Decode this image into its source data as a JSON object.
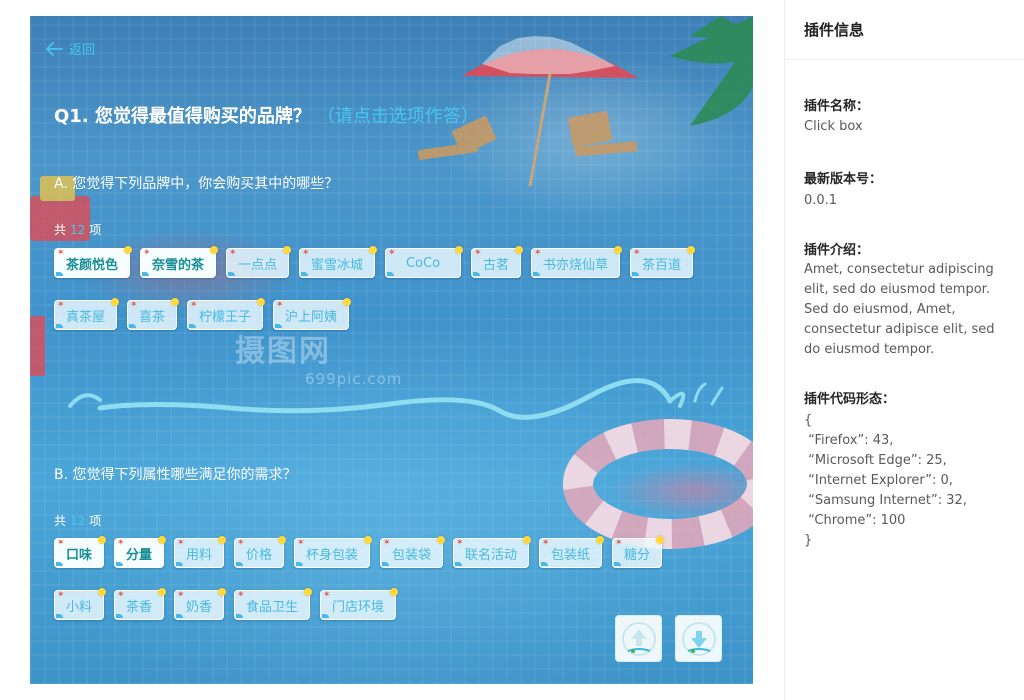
{
  "preview": {
    "back_label": "返回",
    "question_title": "Q1. 您觉得最值得购买的品牌？",
    "question_hint": "（请点击选项作答）",
    "watermark_text": "摄图网",
    "watermark_url": "699pic.com",
    "section_a": {
      "label": "A. 您觉得下列品牌中，你会购买其中的哪些？",
      "count_prefix": "共",
      "count": "12",
      "count_suffix": "项",
      "options": [
        {
          "label": "茶颜悦色",
          "selected": true
        },
        {
          "label": "奈雪的茶",
          "selected": true
        },
        {
          "label": "一点点",
          "selected": false
        },
        {
          "label": "蜜雪冰城",
          "selected": false
        },
        {
          "label": "CoCo",
          "selected": false
        },
        {
          "label": "古茗",
          "selected": false
        },
        {
          "label": "书亦烧仙草",
          "selected": false
        },
        {
          "label": "茶百道",
          "selected": false
        },
        {
          "label": "真茶屋",
          "selected": false
        },
        {
          "label": "喜茶",
          "selected": false
        },
        {
          "label": "柠檬王子",
          "selected": false
        },
        {
          "label": "沪上阿姨",
          "selected": false
        }
      ]
    },
    "section_b": {
      "label": "B. 您觉得下列属性哪些满足你的需求？",
      "count_prefix": "共",
      "count": "12",
      "count_suffix": "项",
      "options": [
        {
          "label": "口味",
          "selected": true
        },
        {
          "label": "分量",
          "selected": true
        },
        {
          "label": "用料",
          "selected": false
        },
        {
          "label": "价格",
          "selected": false
        },
        {
          "label": "杯身包装",
          "selected": false
        },
        {
          "label": "包装袋",
          "selected": false
        },
        {
          "label": "联名活动",
          "selected": false
        },
        {
          "label": "包装纸",
          "selected": false
        },
        {
          "label": "糖分",
          "selected": false
        },
        {
          "label": "小料",
          "selected": false
        },
        {
          "label": "茶香",
          "selected": false
        },
        {
          "label": "奶香",
          "selected": false
        },
        {
          "label": "食品卫生",
          "selected": false
        },
        {
          "label": "门店环境",
          "selected": false
        }
      ]
    },
    "nav": {
      "prev_icon": "up-arrow-icon",
      "next_icon": "down-arrow-icon"
    },
    "colors": {
      "accent": "#48c6f2",
      "selected_text": "#1a8f96"
    }
  },
  "panel": {
    "title": "插件信息",
    "name_label": "插件名称：",
    "name_value": "Click box",
    "version_label": "最新版本号：",
    "version_value": "0.0.1",
    "intro_label": "插件介绍：",
    "intro_value": "Amet, consectetur adipiscing elit, sed do eiusmod tempor. Sed do eiusmod, Amet, consectetur adipisce elit, sed do eiusmod tempor.",
    "code_label": "插件代码形态：",
    "code_lines": [
      "{",
      " “Firefox”: 43,",
      " “Microsoft Edge”: 25,",
      " “Internet Explorer”: 0,",
      " “Samsung Internet”: 32,",
      " “Chrome”: 100",
      "}"
    ]
  }
}
